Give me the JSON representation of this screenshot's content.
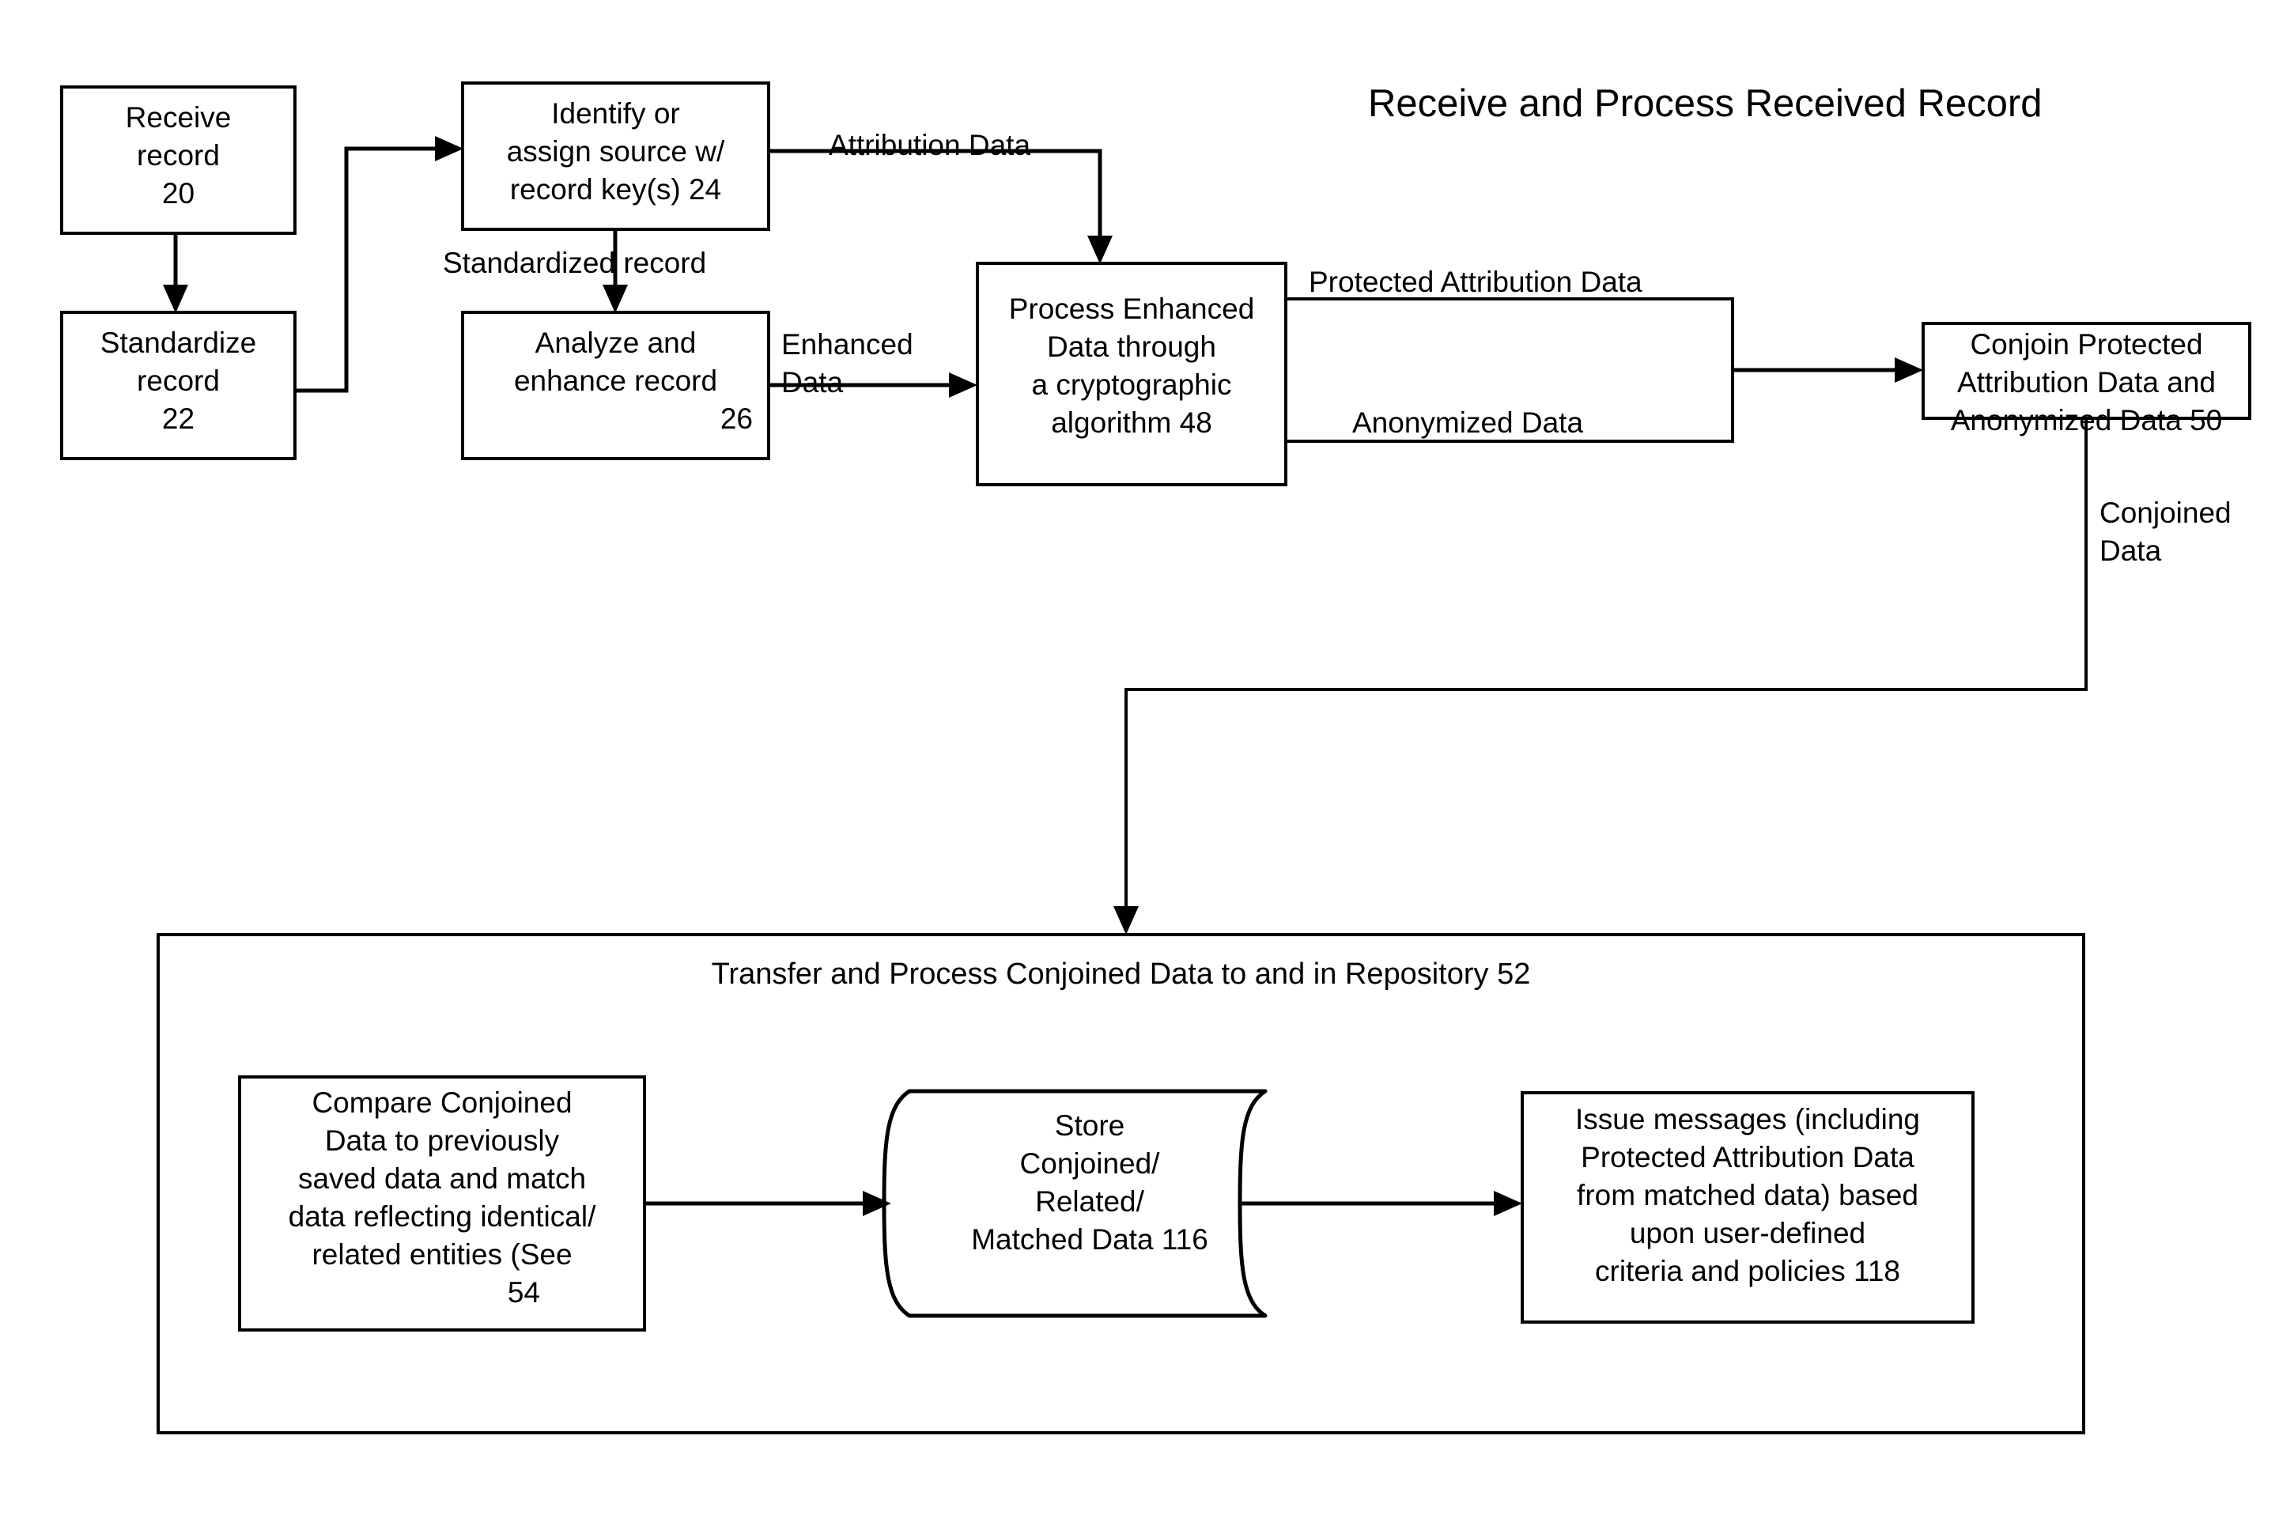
{
  "diagram": {
    "title": "Receive and Process Received Record",
    "nodes": {
      "receive_record": "Receive\nrecord\n20",
      "standardize_record": "Standardize\nrecord\n22",
      "identify_assign_source": "Identify or\nassign source w/\nrecord key(s) 24",
      "analyze_enhance_record_main": "Analyze and\nenhance record",
      "analyze_enhance_record_num": "26",
      "process_enhanced": "Process Enhanced\nData through\na cryptographic\nalgorithm 48",
      "conjoin": "Conjoin Protected\nAttribution Data and\nAnonymized Data 50",
      "repository_title": "Transfer and Process Conjoined Data to and in Repository 52",
      "compare_conjoined_main": "Compare Conjoined\nData to previously\nsaved data and match\ndata reflecting identical/\nrelated entities (See",
      "compare_conjoined_num": "54",
      "store_data": "Store\nConjoined/\nRelated/\nMatched Data 116",
      "issue_messages": "Issue messages (including\nProtected Attribution Data\nfrom matched data) based\nupon user-defined\ncriteria and policies 118"
    },
    "edge_labels": {
      "attribution_data": "Attribution Data",
      "standardized_record": "Standardized record",
      "enhanced_data": "Enhanced\nData",
      "protected_attribution_data": "Protected Attribution Data",
      "anonymized_data": "Anonymized Data",
      "conjoined_data": "Conjoined\nData"
    },
    "colors": {
      "stroke": "#000000",
      "fill": "#ffffff"
    }
  }
}
